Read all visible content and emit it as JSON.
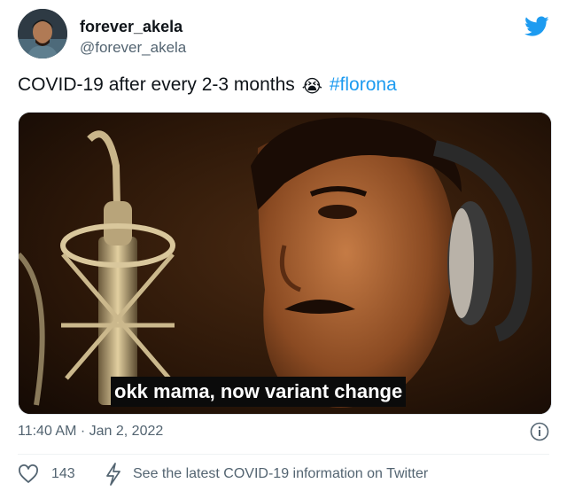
{
  "author": {
    "display_name": "forever_akela",
    "handle": "@forever_akela",
    "avatar_icon": "profile-photo"
  },
  "brand": {
    "icon": "twitter-bird-icon",
    "color": "#1d9bf0"
  },
  "tweet": {
    "text": "COVID-19 after every 2-3 months",
    "emoji": "😭",
    "hashtag": "#florona"
  },
  "media": {
    "caption": "okk mama, now variant change"
  },
  "meta": {
    "timestamp": "11:40 AM · Jan 2, 2022",
    "info_icon": "info-icon"
  },
  "actions": {
    "like_icon": "heart-icon",
    "like_count": "143",
    "bolt_icon": "lightning-icon",
    "info_link": "See the latest COVID-19 information on Twitter"
  }
}
